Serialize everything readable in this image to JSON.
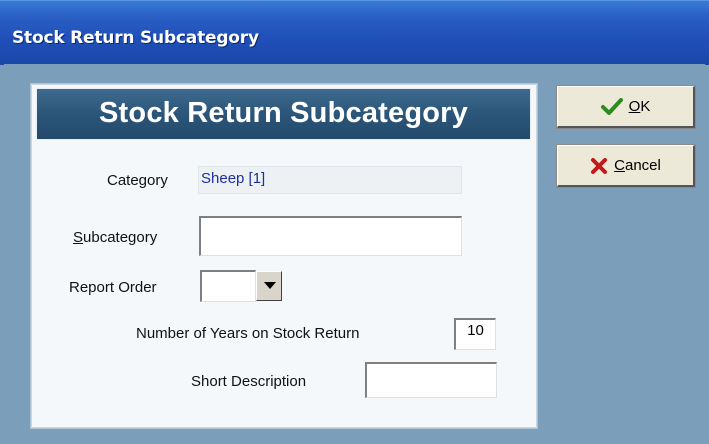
{
  "window": {
    "title": "Stock Return Subcategory"
  },
  "panel": {
    "heading": "Stock Return Subcategory"
  },
  "form": {
    "category_label": "Category",
    "category_value": "Sheep [1]",
    "subcategory_label_prefix": "S",
    "subcategory_label_rest": "ubcategory",
    "subcategory_value": "",
    "report_order_label": "Report Order",
    "report_order_value": "",
    "years_label": "Number of Years on Stock Return",
    "years_value": "10",
    "short_desc_label": "Short Description",
    "short_desc_value": ""
  },
  "buttons": {
    "ok_mnemonic": "O",
    "ok_rest": "K",
    "cancel_mnemonic": "C",
    "cancel_rest": "ancel"
  },
  "colors": {
    "ok_check": "#2e8b1e",
    "cancel_x": "#c21a1a",
    "client_bg": "#7b9fbb",
    "header_bg": "#2a5478"
  },
  "icons": {
    "ok": "check-icon",
    "cancel": "x-icon",
    "dropdown": "chevron-down-icon"
  }
}
